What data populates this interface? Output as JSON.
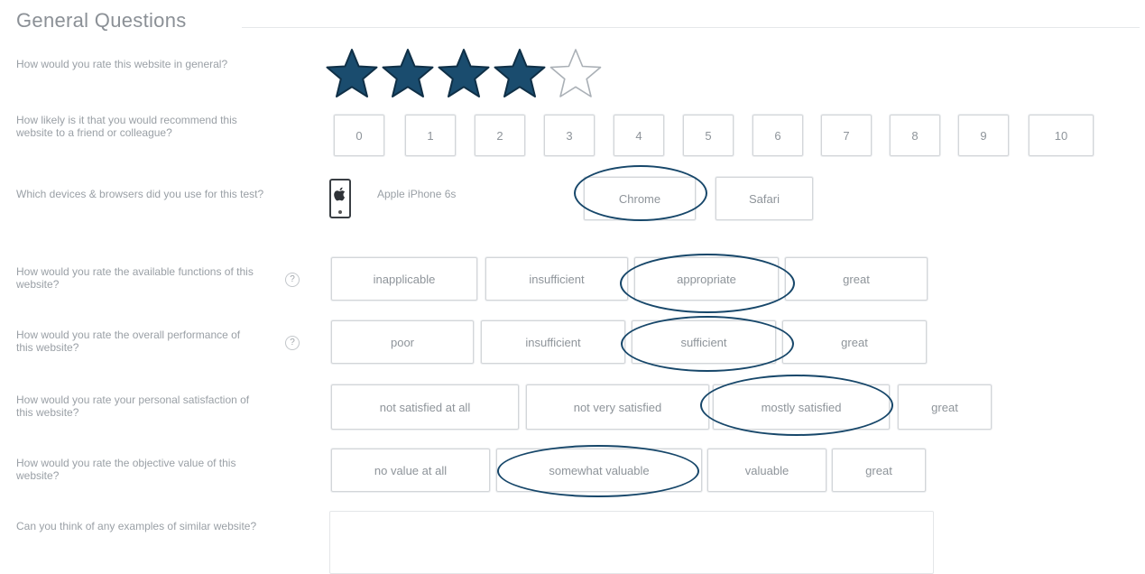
{
  "section": {
    "title": "General Questions"
  },
  "questions": {
    "rating": {
      "label": "How would you rate this website in general?",
      "stars_filled": 4,
      "stars_total": 5
    },
    "recommend": {
      "label": "How likely is it that you would recommend this website to a friend or colleague?",
      "options": [
        "0",
        "1",
        "2",
        "3",
        "4",
        "5",
        "6",
        "7",
        "8",
        "9",
        "10"
      ]
    },
    "devices": {
      "label": "Which devices & browsers did you use for this test?",
      "device_icon": "apple-phone-icon",
      "device_name": "Apple iPhone 6s",
      "browsers": [
        "Chrome",
        "Safari"
      ],
      "selected": "Chrome"
    },
    "functions": {
      "label": "How would you rate the available functions of this website?",
      "help": "?",
      "options": [
        "inapplicable",
        "insufficient",
        "appropriate",
        "great"
      ],
      "selected": "appropriate"
    },
    "performance": {
      "label": "How would you rate the overall performance of this website?",
      "help": "?",
      "options": [
        "poor",
        "insufficient",
        "sufficient",
        "great"
      ],
      "selected": "sufficient"
    },
    "satisfaction": {
      "label": "How would you rate your personal satisfaction of this website?",
      "options": [
        "not satisfied at all",
        "not very satisfied",
        "mostly satisfied",
        "great"
      ],
      "selected": "mostly satisfied"
    },
    "value": {
      "label": "How would you rate the objective value of this website?",
      "options": [
        "no value at all",
        "somewhat valuable",
        "valuable",
        "great"
      ],
      "selected": "somewhat valuable"
    },
    "similar": {
      "label": "Can you think of any examples of similar website?",
      "value": ""
    }
  },
  "colors": {
    "star_fill": "#1a4c6e",
    "highlight_circle": "#17476a",
    "option_border": "#d3d6d9"
  }
}
